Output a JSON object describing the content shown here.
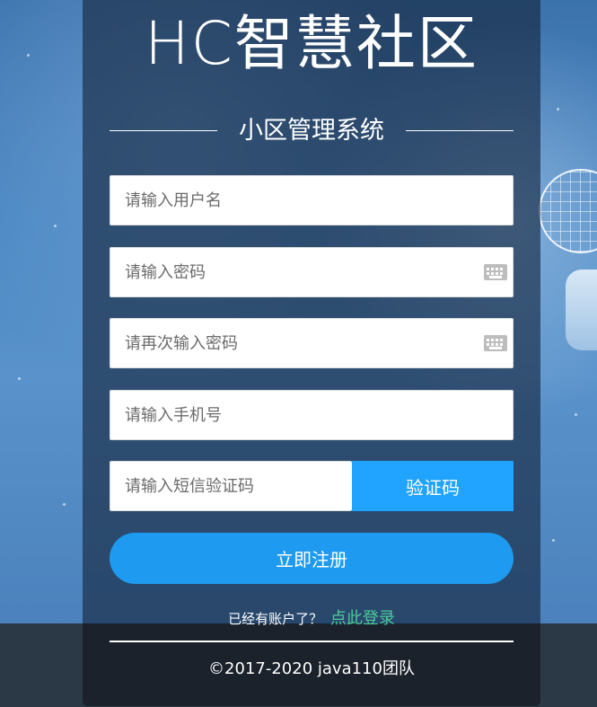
{
  "brand": {
    "title": "HC智慧社区",
    "subtitle": "小区管理系统"
  },
  "form": {
    "username": {
      "value": "",
      "placeholder": "请输入用户名"
    },
    "password": {
      "value": "",
      "placeholder": "请输入密码"
    },
    "password_confirm": {
      "value": "",
      "placeholder": "请再次输入密码"
    },
    "phone": {
      "value": "",
      "placeholder": "请输入手机号"
    },
    "sms_code": {
      "value": "",
      "placeholder": "请输入短信验证码"
    },
    "get_code_label": "验证码",
    "register_label": "立即注册"
  },
  "login_prompt": {
    "text": "已经有账户了？",
    "link": "点此登录"
  },
  "footer": {
    "copyright": "©2017-2020 java110团队"
  },
  "icons": {
    "password_toggle": "keyboard-icon",
    "password_confirm_toggle": "keyboard-icon"
  },
  "colors": {
    "accent": "#21a4ff",
    "register": "#1e9bf0",
    "login_link": "#4ecb9b",
    "panel": "#14243a",
    "footer": "#1b222b"
  }
}
